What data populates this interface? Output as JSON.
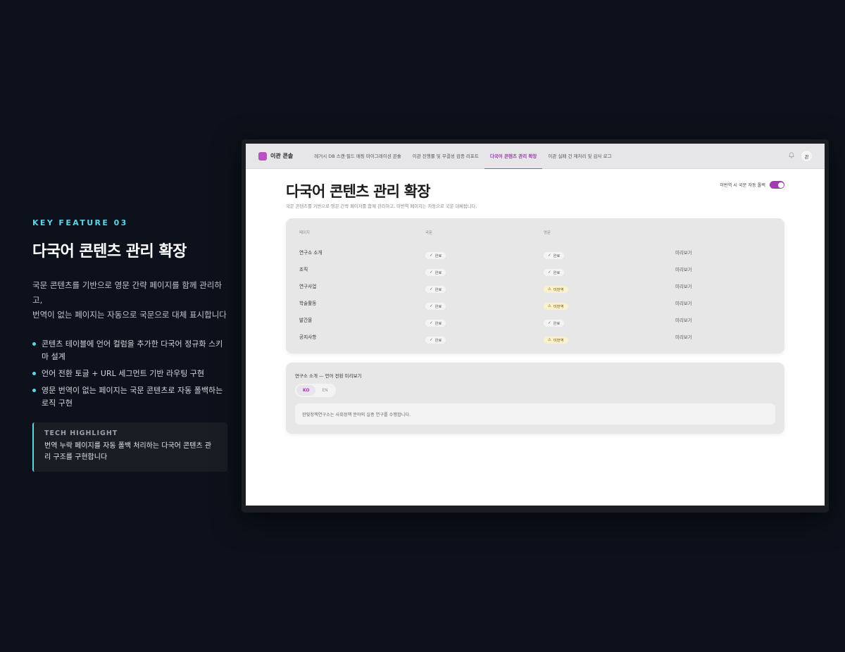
{
  "feature": {
    "eyebrow": "KEY FEATURE 03",
    "title": "다국어 콘텐츠 관리 확장",
    "description": [
      "국문 콘텐츠를 기반으로 영문 간략 페이지를 함께 관리하고,",
      "번역이 없는 페이지는 자동으로 국문으로 대체 표시합니다"
    ],
    "bullets": [
      "콘텐츠 테이블에 언어 컬럼을 추가한 다국어 정규화 스키마 설계",
      "언어 전환 토글 + URL 세그먼트 기반 라우팅 구현",
      "영문 번역이 없는 페이지는 국문 콘텐츠로 자동 폴백하는 로직 구현"
    ],
    "highlight": {
      "title": "TECH HIGHLIGHT",
      "text": "번역 누락 페이지를 자동 폴백 처리하는 다국어 콘텐츠 관리 구조를 구현합니다"
    },
    "accent_color": "#5fd4e8"
  },
  "app": {
    "brand": "이관 콘솔",
    "brand_color": "#b84fc3",
    "nav": [
      {
        "label": "레거시 DB 스캔·필드 매핑 마이그레이션 콘솔",
        "active": false
      },
      {
        "label": "이관 진행률 및 무결성 검증 리포트",
        "active": false
      },
      {
        "label": "다국어 콘텐츠 관리 확장",
        "active": true
      },
      {
        "label": "이관 실패 건 재처리 및 감사 로그",
        "active": false
      }
    ],
    "bell_icon": "bell-icon",
    "avatar": "관"
  },
  "page": {
    "title": "다국어 콘텐츠 관리 확장",
    "subtitle": "국문 콘텐츠를 기반으로 영문 간략 페이지를 함께 관리하고, 미번역 페이지는 자동으로 국문 대체됩니다.",
    "fallback_label": "미번역 시 국문 자동 폴백",
    "fallback_on": true
  },
  "table": {
    "headers": [
      "페이지",
      "국문",
      "영문",
      ""
    ],
    "rows": [
      {
        "page": "연구소 소개",
        "ko": "완료",
        "en": "완료",
        "en_status": "done",
        "action": "미리보기"
      },
      {
        "page": "조직",
        "ko": "완료",
        "en": "완료",
        "en_status": "done",
        "action": "미리보기"
      },
      {
        "page": "연구사업",
        "ko": "완료",
        "en": "미번역",
        "en_status": "missing",
        "action": "미리보기"
      },
      {
        "page": "학술활동",
        "ko": "완료",
        "en": "미번역",
        "en_status": "missing",
        "action": "미리보기"
      },
      {
        "page": "발간물",
        "ko": "완료",
        "en": "완료",
        "en_status": "done",
        "action": "미리보기"
      },
      {
        "page": "공지사항",
        "ko": "완료",
        "en": "미번역",
        "en_status": "missing",
        "action": "미리보기"
      }
    ]
  },
  "preview": {
    "title": "연구소 소개 — 언어 전환 미리보기",
    "langs": [
      "KO",
      "EN"
    ],
    "active_lang": "KO",
    "text": "한빛정책연구소는 사회정책 분야의 실증 연구를 수행합니다."
  }
}
